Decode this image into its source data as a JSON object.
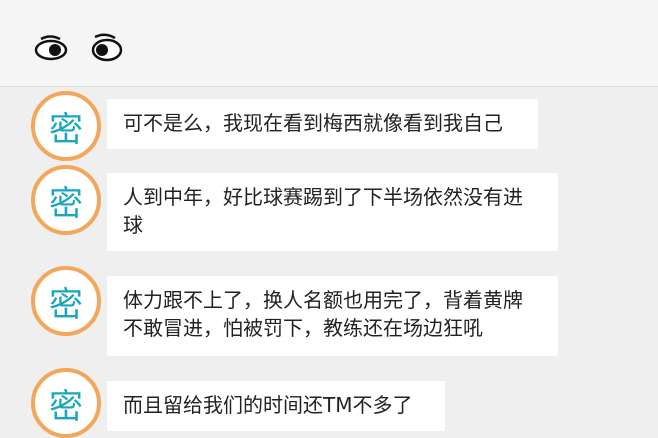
{
  "chat": {
    "avatar_text": "密",
    "messages": [
      {
        "text": "可不是么，我现在看到梅西就像看到我自己"
      },
      {
        "text": "人到中年，好比球赛踢到了下半场依然没有进球"
      },
      {
        "text": "体力跟不上了，换人名额也用完了，背着黄牌不敢冒进，怕被罚下，教练还在场边狂吼"
      },
      {
        "text": "而且留给我们的时间还TM不多了"
      }
    ]
  },
  "colors": {
    "avatar_border": "#f3a75b",
    "avatar_glyph": "#1aa6bd",
    "background": "#efefef"
  }
}
